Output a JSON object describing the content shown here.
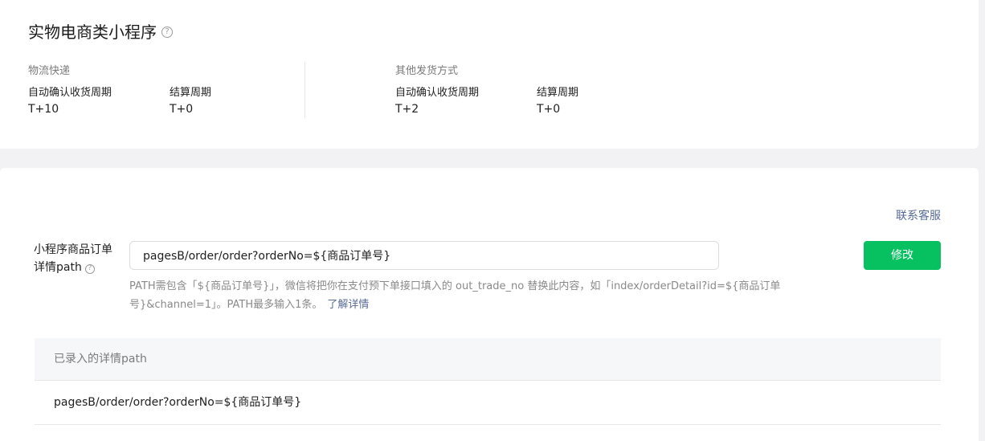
{
  "header": {
    "title": "实物电商类小程序",
    "help_icon": "?"
  },
  "logistics": {
    "title": "物流快递",
    "auto_confirm_label": "自动确认收货周期",
    "auto_confirm_value": "T+10",
    "settlement_label": "结算周期",
    "settlement_value": "T+0"
  },
  "other_shipping": {
    "title": "其他发货方式",
    "auto_confirm_label": "自动确认收货周期",
    "auto_confirm_value": "T+2",
    "settlement_label": "结算周期",
    "settlement_value": "T+0"
  },
  "contact": {
    "label": "联系客服"
  },
  "order_path": {
    "label": "小程序商品订单详情path",
    "help_icon": "?",
    "input_value": "pagesB/order/order?orderNo=${商品订单号}",
    "edit_button": "修改",
    "hint": "PATH需包含「${商品订单号}」，微信将把你在支付预下单接口填入的 out_trade_no 替换此内容，如「index/orderDetail?id=${商品订单号}&channel=1」。PATH最多输入1条。",
    "learn_more": "了解详情"
  },
  "recorded_paths": {
    "header": "已录入的详情path",
    "rows": [
      "pagesB/order/order?orderNo=${商品订单号}"
    ]
  },
  "colors": {
    "accent_green": "#07c160",
    "link_blue": "#576b95"
  }
}
